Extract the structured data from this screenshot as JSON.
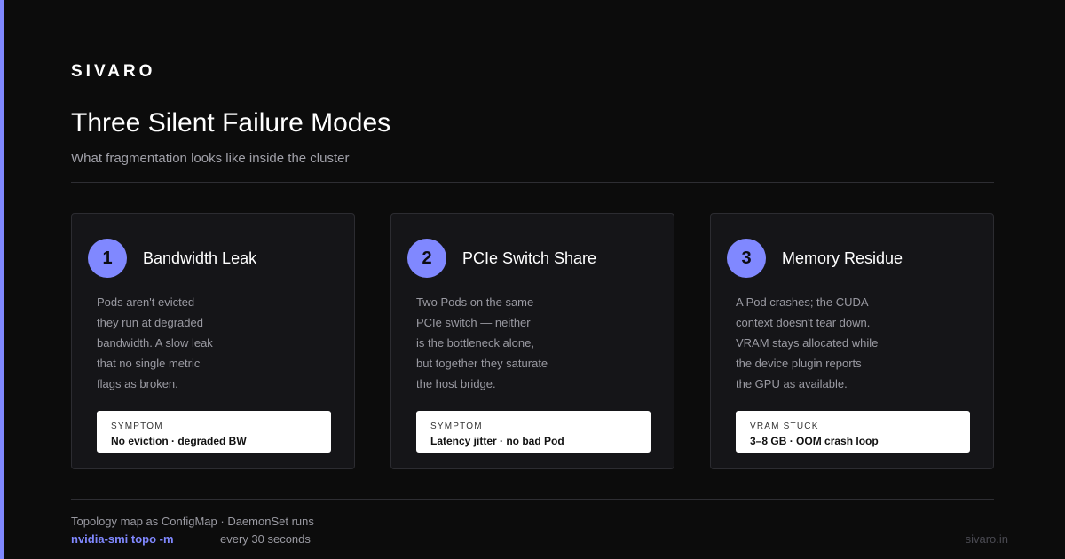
{
  "brand": "SIVARO",
  "title": "Three Silent Failure Modes",
  "subtitle": "What fragmentation looks like inside the cluster",
  "cards": [
    {
      "number": "1",
      "title": "Bandwidth Leak",
      "body": [
        "Pods aren't evicted —",
        "they run at degraded",
        "bandwidth. A slow leak",
        "that no single metric",
        "flags as broken."
      ],
      "tag_label": "SYMPTOM",
      "tag_value": "No eviction · degraded BW"
    },
    {
      "number": "2",
      "title": "PCIe Switch Share",
      "body": [
        "Two Pods on the same",
        "PCIe switch — neither",
        "is the bottleneck alone,",
        "but together they saturate",
        "the host bridge."
      ],
      "tag_label": "SYMPTOM",
      "tag_value": "Latency jitter · no bad Pod"
    },
    {
      "number": "3",
      "title": "Memory Residue",
      "body": [
        "A Pod crashes; the CUDA",
        "context doesn't tear down.",
        "VRAM stays allocated while",
        "the device plugin reports",
        "the GPU as available."
      ],
      "tag_label": "VRAM STUCK",
      "tag_value": "3–8 GB · OOM crash loop"
    }
  ],
  "footer": {
    "line1": "Topology map as ConfigMap · DaemonSet runs",
    "command": "nvidia-smi topo -m",
    "line2": "every 30 seconds",
    "url": "sivaro.in"
  },
  "colors": {
    "accent": "#8088ff",
    "background": "#0c0c0c",
    "card": "#151518"
  }
}
